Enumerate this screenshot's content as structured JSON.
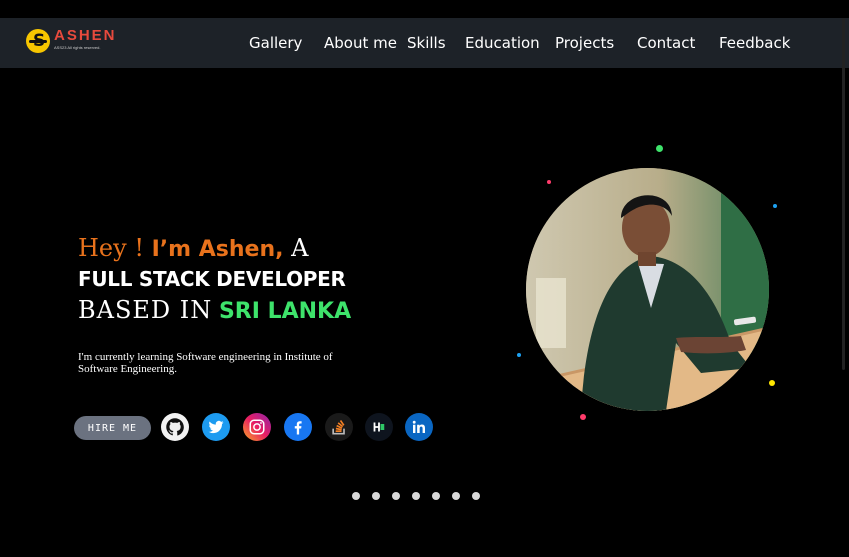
{
  "brand": {
    "name": "ASHEN",
    "tagline": "ASS23 All rights reserved.",
    "accent": "#e84a3d",
    "mark_color": "#f7c600"
  },
  "nav": {
    "items": [
      {
        "label": "Gallery"
      },
      {
        "label": "About me"
      },
      {
        "label": "Skills"
      },
      {
        "label": "Education"
      },
      {
        "label": "Projects"
      },
      {
        "label": "Contact"
      },
      {
        "label": "Feedback"
      }
    ]
  },
  "hero": {
    "greeting": "Hey !",
    "name": "I’m Ashen,",
    "article": "A",
    "role": "FULL STACK DEVELOPER",
    "based": "BASED IN",
    "location": "SRI LANKA",
    "description": "I'm currently learning Software engineering in Institute of Software Engineering.",
    "hire_label": "HIRE ME",
    "accent_orange": "#e8721c",
    "accent_green": "#3ee36b"
  },
  "socials": [
    {
      "icon": "github-icon"
    },
    {
      "icon": "twitter-icon"
    },
    {
      "icon": "instagram-icon"
    },
    {
      "icon": "facebook-icon"
    },
    {
      "icon": "stackoverflow-icon"
    },
    {
      "icon": "hackerrank-icon"
    },
    {
      "icon": "linkedin-icon"
    }
  ],
  "pager": {
    "count": 7
  }
}
